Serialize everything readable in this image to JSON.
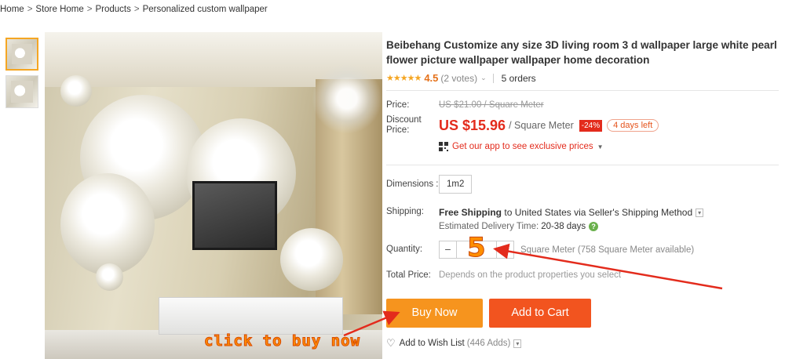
{
  "breadcrumb": [
    "Home",
    "Store Home",
    "Products",
    "Personalized custom wallpaper"
  ],
  "product": {
    "title": "Beibehang Customize any size 3D living room 3 d wallpaper large white pearl flower picture wallpaper wallpaper home decoration",
    "stars": "★★★★★",
    "rating": "4.5",
    "votes": "(2 votes)",
    "orders": "5 orders"
  },
  "pricing": {
    "price_label": "Price:",
    "original_price": "US $21.00 / Square Meter",
    "discount_label": "Discount Price:",
    "discount_price": "US $15.96",
    "unit": "/ Square Meter",
    "discount_badge": "-24%",
    "time_left": "4 days left",
    "app_offer": "Get our app to see exclusive prices"
  },
  "options": {
    "dimensions_label": "Dimensions :",
    "dimension_value": "1m2",
    "shipping_label": "Shipping:",
    "shipping_free": "Free Shipping",
    "shipping_rest": "to United States via Seller's Shipping Method",
    "delivery_label": "Estimated Delivery Time:",
    "delivery_days": "20-38 days",
    "quantity_label": "Quantity:",
    "quantity_minus": "−",
    "quantity_value": "",
    "quantity_plus": "+",
    "availability": "Square Meter (758 Square Meter available)",
    "total_label": "Total Price:",
    "total_note": "Depends on the product properties you select"
  },
  "actions": {
    "buy_now": "Buy Now",
    "add_to_cart": "Add to Cart",
    "wishlist": "Add to Wish List",
    "wishlist_count": "(446 Adds)"
  },
  "annotations": {
    "click_to_buy": "click to buy now",
    "quantity_marker": "5"
  },
  "colors": {
    "price_red": "#e32b1c",
    "buy_now_orange": "#f6941e",
    "add_to_cart_orange": "#f2541f",
    "annotation_orange": "#ff8f00"
  }
}
